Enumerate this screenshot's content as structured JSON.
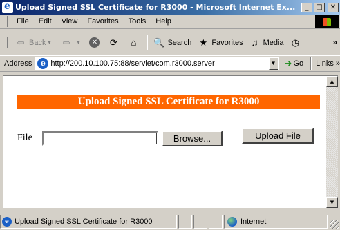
{
  "window": {
    "title": "Upload Signed SSL Certificate for R3000 - Microsoft Internet Ex...",
    "minimize_glyph": "_",
    "maximize_glyph": "□",
    "close_glyph": "✕"
  },
  "menubar": {
    "items": [
      "File",
      "Edit",
      "View",
      "Favorites",
      "Tools",
      "Help"
    ]
  },
  "toolbar": {
    "back_label": "Back",
    "search_label": "Search",
    "favorites_label": "Favorites",
    "media_label": "Media",
    "overflow_glyph": "»"
  },
  "addressbar": {
    "label": "Address",
    "url": "http://200.10.100.75:88/servlet/com.r3000.server",
    "go_label": "Go",
    "links_label": "Links »"
  },
  "page": {
    "banner_title": "Upload Signed SSL Certificate for R3000",
    "file_label": "File",
    "file_value": "",
    "browse_label": "Browse...",
    "upload_label": "Upload File",
    "banner_color": "#ff6600"
  },
  "statusbar": {
    "text": "Upload Signed SSL Certificate for R3000",
    "zone": "Internet"
  }
}
